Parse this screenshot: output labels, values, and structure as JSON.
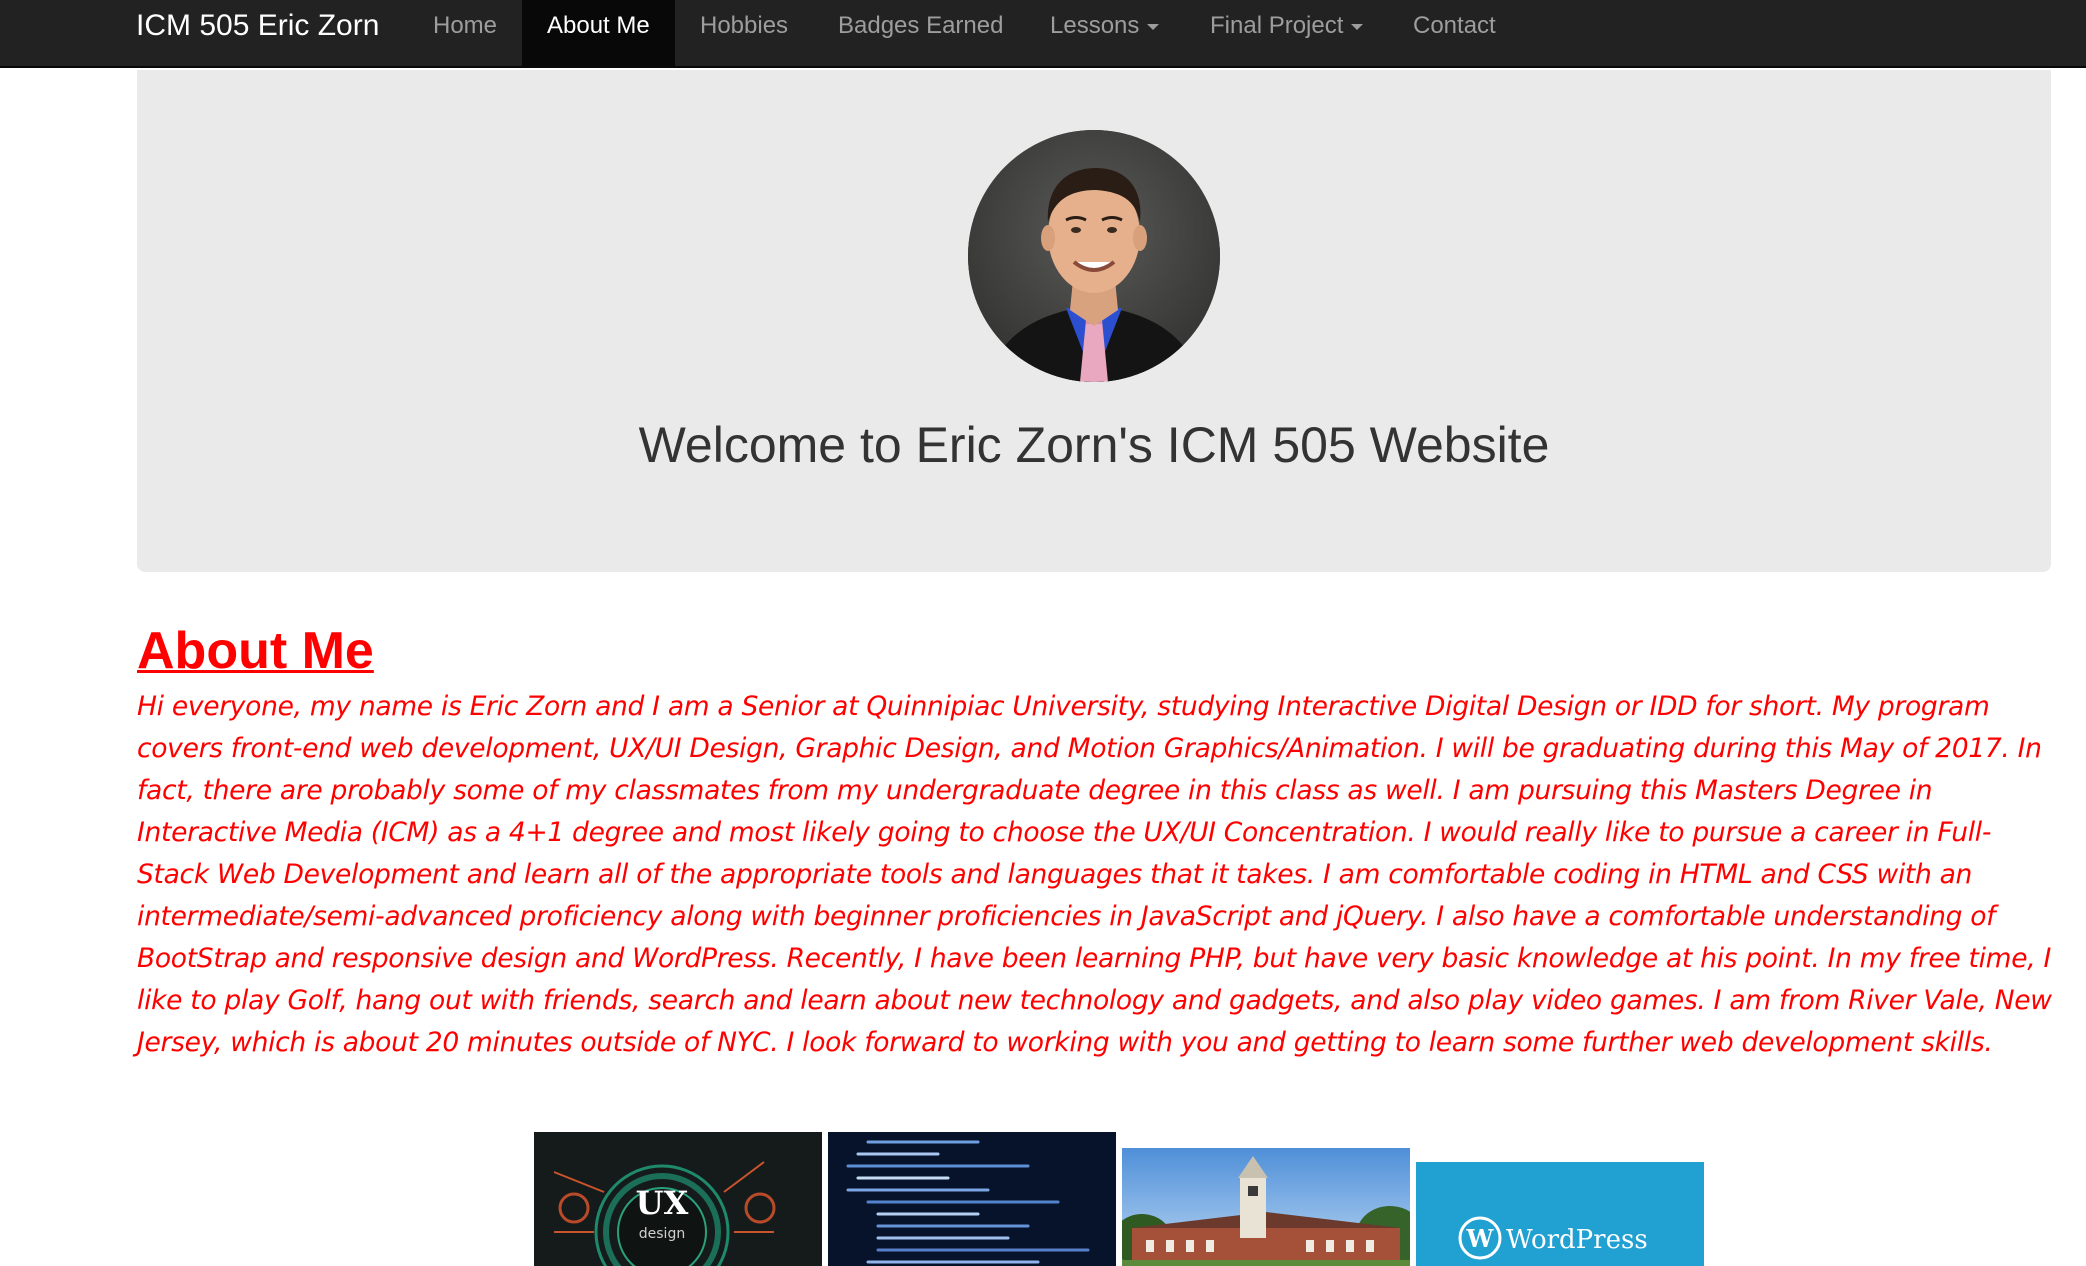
{
  "navbar": {
    "brand": "ICM 505 Eric Zorn",
    "items": [
      {
        "label": "Home"
      },
      {
        "label": "About Me"
      },
      {
        "label": "Hobbies"
      },
      {
        "label": "Badges Earned"
      },
      {
        "label": "Lessons"
      },
      {
        "label": "Final Project"
      },
      {
        "label": "Contact"
      }
    ]
  },
  "jumbotron": {
    "welcome": "Welcome to Eric Zorn's ICM 505 Website"
  },
  "about": {
    "heading": "About Me",
    "body": "Hi everyone, my name is Eric Zorn and I am a Senior at Quinnipiac University, studying Interactive Digital Design or IDD for short. My program covers front-end web development, UX/UI Design, Graphic Design, and Motion Graphics/Animation. I will be graduating during this May of 2017. In fact, there are probably some of my classmates from my undergraduate degree in this class as well. I am pursuing this Masters Degree in Interactive Media (ICM) as a 4+1 degree and most likely going to choose the UX/UI Concentration. I would really like to pursue a career in Full-Stack Web Development and learn all of the appropriate tools and languages that it takes. I am comfortable coding in HTML and CSS with an intermediate/semi-advanced proficiency along with beginner proficiencies in JavaScript and jQuery. I also have a comfortable understanding of BootStrap and responsive design and WordPress. Recently, I have been learning PHP, but have very basic knowledge at his point. In my free time, I like to play Golf, hang out with friends, search and learn about new technology and gadgets, and also play video games. I am from River Vale, New Jersey, which is about 20 minutes outside of NYC. I look forward to working with you and getting to learn some further web development skills."
  },
  "thumbnails": {
    "ux": {
      "title": "UX",
      "subtitle": "design"
    },
    "wordpress": {
      "label": "WordPress"
    }
  },
  "colors": {
    "navbar_bg": "#222222",
    "nav_active_bg": "#080808",
    "nav_text": "#9d9d9d",
    "jumbotron_bg": "#eaeaea",
    "accent_red": "#ff0000",
    "wordpress_blue": "#21a0d2"
  }
}
